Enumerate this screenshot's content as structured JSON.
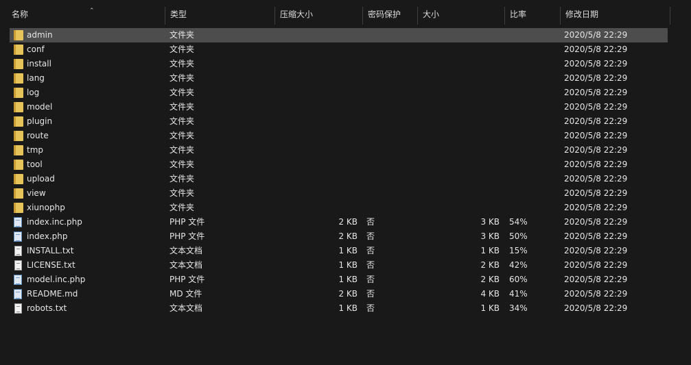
{
  "columns": {
    "name": "名称",
    "type": "类型",
    "compressed_size": "压缩大小",
    "password": "密码保护",
    "size": "大小",
    "ratio": "比率",
    "modified": "修改日期"
  },
  "sort_icon": "chevron-up-icon",
  "rows": [
    {
      "name": "admin",
      "type": "文件夹",
      "csize": "",
      "enc": "",
      "size": "",
      "ratio": "",
      "date": "2020/5/8 22:29",
      "icon": "folder-icon",
      "selected": true
    },
    {
      "name": "conf",
      "type": "文件夹",
      "csize": "",
      "enc": "",
      "size": "",
      "ratio": "",
      "date": "2020/5/8 22:29",
      "icon": "folder-icon"
    },
    {
      "name": "install",
      "type": "文件夹",
      "csize": "",
      "enc": "",
      "size": "",
      "ratio": "",
      "date": "2020/5/8 22:29",
      "icon": "folder-icon"
    },
    {
      "name": "lang",
      "type": "文件夹",
      "csize": "",
      "enc": "",
      "size": "",
      "ratio": "",
      "date": "2020/5/8 22:29",
      "icon": "folder-icon"
    },
    {
      "name": "log",
      "type": "文件夹",
      "csize": "",
      "enc": "",
      "size": "",
      "ratio": "",
      "date": "2020/5/8 22:29",
      "icon": "folder-icon"
    },
    {
      "name": "model",
      "type": "文件夹",
      "csize": "",
      "enc": "",
      "size": "",
      "ratio": "",
      "date": "2020/5/8 22:29",
      "icon": "folder-icon"
    },
    {
      "name": "plugin",
      "type": "文件夹",
      "csize": "",
      "enc": "",
      "size": "",
      "ratio": "",
      "date": "2020/5/8 22:29",
      "icon": "folder-icon"
    },
    {
      "name": "route",
      "type": "文件夹",
      "csize": "",
      "enc": "",
      "size": "",
      "ratio": "",
      "date": "2020/5/8 22:29",
      "icon": "folder-icon"
    },
    {
      "name": "tmp",
      "type": "文件夹",
      "csize": "",
      "enc": "",
      "size": "",
      "ratio": "",
      "date": "2020/5/8 22:29",
      "icon": "folder-icon"
    },
    {
      "name": "tool",
      "type": "文件夹",
      "csize": "",
      "enc": "",
      "size": "",
      "ratio": "",
      "date": "2020/5/8 22:29",
      "icon": "folder-icon"
    },
    {
      "name": "upload",
      "type": "文件夹",
      "csize": "",
      "enc": "",
      "size": "",
      "ratio": "",
      "date": "2020/5/8 22:29",
      "icon": "folder-icon"
    },
    {
      "name": "view",
      "type": "文件夹",
      "csize": "",
      "enc": "",
      "size": "",
      "ratio": "",
      "date": "2020/5/8 22:29",
      "icon": "folder-icon"
    },
    {
      "name": "xiunophp",
      "type": "文件夹",
      "csize": "",
      "enc": "",
      "size": "",
      "ratio": "",
      "date": "2020/5/8 22:29",
      "icon": "folder-icon"
    },
    {
      "name": "index.inc.php",
      "type": "PHP 文件",
      "csize": "2 KB",
      "enc": "否",
      "size": "3 KB",
      "ratio": "54%",
      "date": "2020/5/8 22:29",
      "icon": "script-file-icon"
    },
    {
      "name": "index.php",
      "type": "PHP 文件",
      "csize": "2 KB",
      "enc": "否",
      "size": "3 KB",
      "ratio": "50%",
      "date": "2020/5/8 22:29",
      "icon": "script-file-icon"
    },
    {
      "name": "INSTALL.txt",
      "type": "文本文档",
      "csize": "1 KB",
      "enc": "否",
      "size": "1 KB",
      "ratio": "15%",
      "date": "2020/5/8 22:29",
      "icon": "text-file-icon"
    },
    {
      "name": "LICENSE.txt",
      "type": "文本文档",
      "csize": "1 KB",
      "enc": "否",
      "size": "2 KB",
      "ratio": "42%",
      "date": "2020/5/8 22:29",
      "icon": "text-file-icon"
    },
    {
      "name": "model.inc.php",
      "type": "PHP 文件",
      "csize": "1 KB",
      "enc": "否",
      "size": "2 KB",
      "ratio": "60%",
      "date": "2020/5/8 22:29",
      "icon": "script-file-icon"
    },
    {
      "name": "README.md",
      "type": "MD 文件",
      "csize": "2 KB",
      "enc": "否",
      "size": "4 KB",
      "ratio": "41%",
      "date": "2020/5/8 22:29",
      "icon": "script-file-icon"
    },
    {
      "name": "robots.txt",
      "type": "文本文档",
      "csize": "1 KB",
      "enc": "否",
      "size": "1 KB",
      "ratio": "34%",
      "date": "2020/5/8 22:29",
      "icon": "text-file-icon"
    }
  ]
}
